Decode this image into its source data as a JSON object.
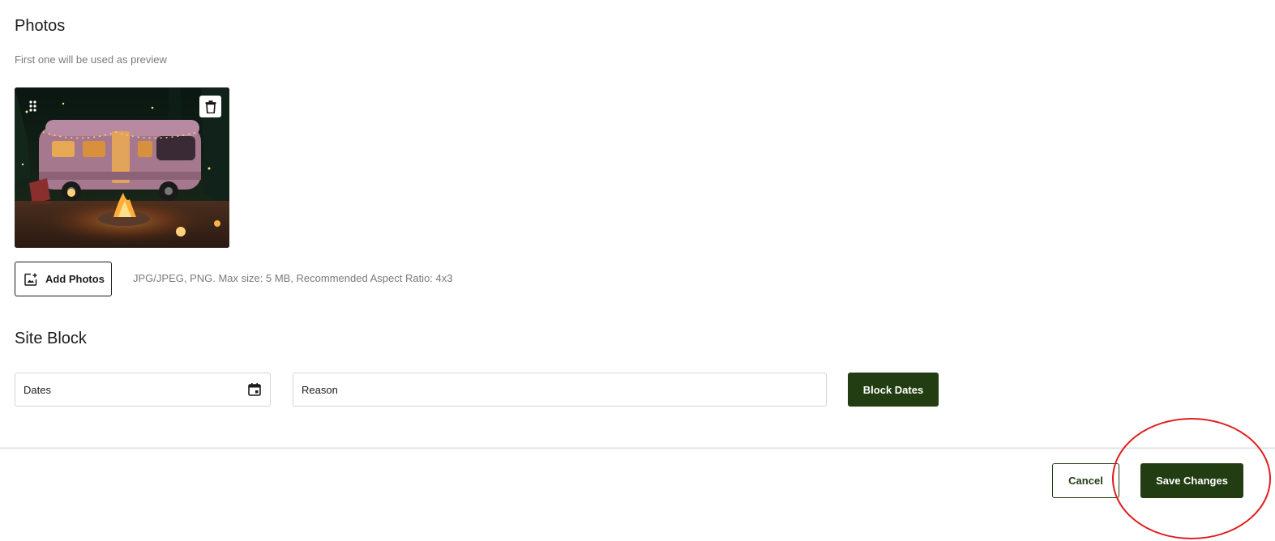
{
  "photos": {
    "title": "Photos",
    "subtitle": "First one will be used as preview",
    "items": [
      {
        "icon_drag": "drag-handle-icon",
        "icon_delete": "trash-icon"
      }
    ],
    "add_button_label": "Add Photos",
    "add_button_icon": "add-image-icon",
    "hint": "JPG/JPEG, PNG. Max size: 5 MB, Recommended Aspect Ratio: 4x3"
  },
  "site_block": {
    "title": "Site Block",
    "dates_placeholder": "Dates",
    "dates_icon": "calendar-icon",
    "reason_placeholder": "Reason",
    "block_button_label": "Block Dates"
  },
  "footer": {
    "cancel_label": "Cancel",
    "save_label": "Save Changes"
  },
  "colors": {
    "primary": "#223d11",
    "annotation": "#e01d1d"
  }
}
